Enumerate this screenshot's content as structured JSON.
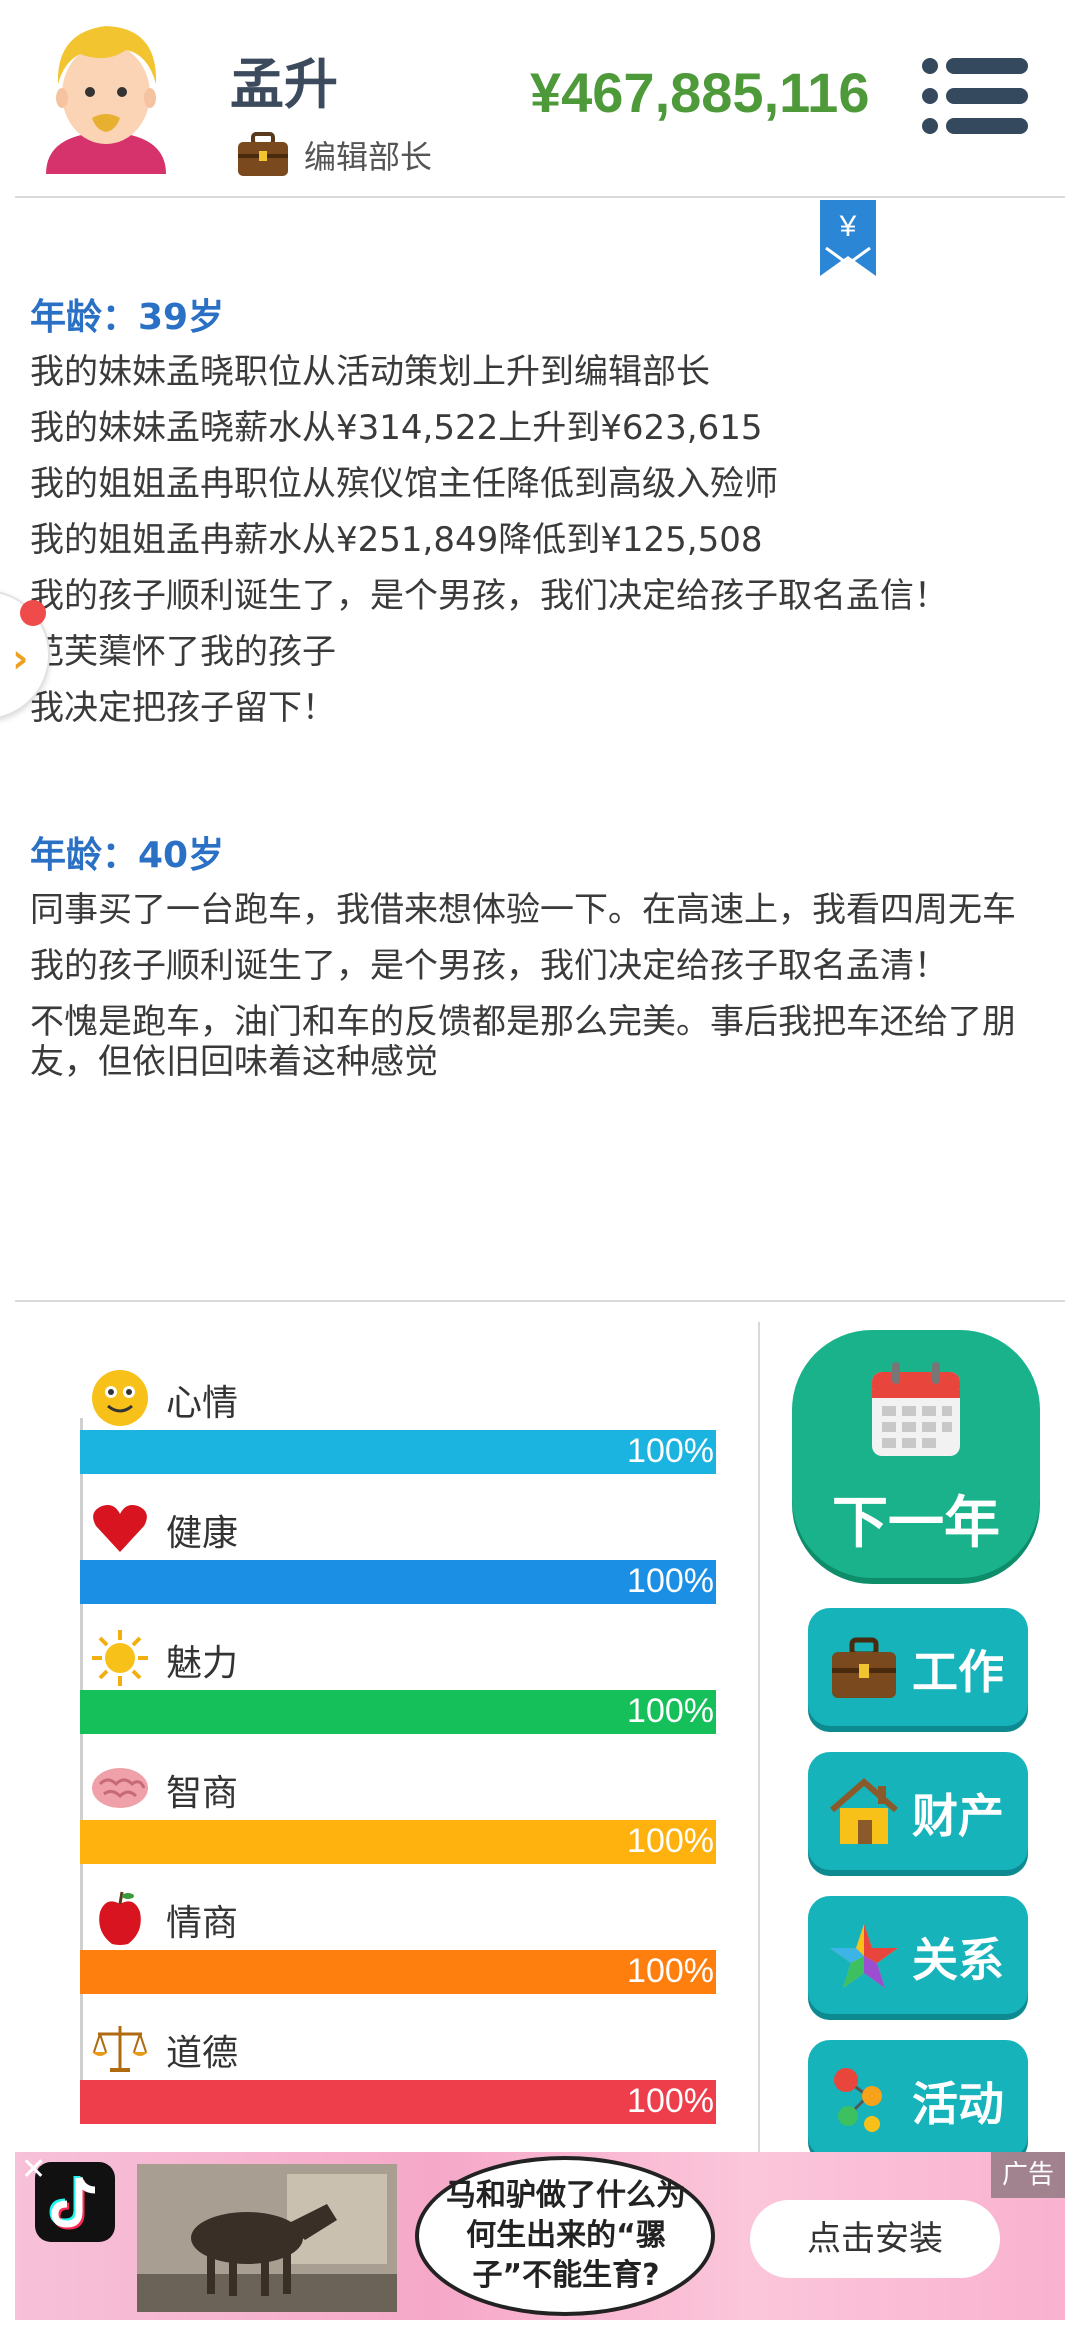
{
  "header": {
    "name": "孟升",
    "job": "编辑部长",
    "money": "¥467,885,116"
  },
  "bookmark": {
    "symbol": "¥"
  },
  "log": [
    {
      "age": "年龄：39岁",
      "lines": [
        "我的妹妹孟晓职位从活动策划上升到编辑部长",
        "我的妹妹孟晓薪水从¥314,522上升到¥623,615",
        "我的姐姐孟冉职位从殡仪馆主任降低到高级入殓师",
        "我的姐姐孟冉薪水从¥251,849降低到¥125,508",
        "我的孩子顺利诞生了，是个男孩，我们决定给孩子取名孟信！",
        "范芙蕖怀了我的孩子",
        "我决定把孩子留下！"
      ]
    },
    {
      "age": "年龄：40岁",
      "lines": [
        "同事买了一台跑车，我借来想体验一下。在高速上，我看四周无车",
        "我的孩子顺利诞生了，是个男孩，我们决定给孩子取名孟清！",
        "不愧是跑车，油门和车的反馈都是那么完美。事后我把车还给了朋友，但依旧回味着这种感觉"
      ]
    }
  ],
  "stats": [
    {
      "label": "心情",
      "value": "100%",
      "fraction": 1.0,
      "color": "#1bb3e0",
      "icon": "smiley-icon"
    },
    {
      "label": "健康",
      "value": "100%",
      "fraction": 1.0,
      "color": "#1a8fe3",
      "icon": "heart-icon"
    },
    {
      "label": "魅力",
      "value": "100%",
      "fraction": 1.0,
      "color": "#15c05a",
      "icon": "sun-icon"
    },
    {
      "label": "智商",
      "value": "100%",
      "fraction": 1.0,
      "color": "#ffb20e",
      "icon": "brain-icon"
    },
    {
      "label": "情商",
      "value": "100%",
      "fraction": 1.0,
      "color": "#ff7f0e",
      "icon": "apple-icon"
    },
    {
      "label": "道德",
      "value": "100%",
      "fraction": 1.0,
      "color": "#ee3d4b",
      "icon": "scales-icon"
    }
  ],
  "actions": {
    "next_year": "下一年",
    "work": "工作",
    "property": "财产",
    "relations": "关系",
    "activity": "活动"
  },
  "ad": {
    "bubble": "马和驴做了什么为何生出来的“骡子”不能生育?",
    "install": "点击安装",
    "tag": "广告",
    "close": "✕"
  },
  "colors": {
    "money": "#4e9a3a",
    "age": "#2a70c5",
    "next_year_bg": "#19b28a",
    "action_bg": "#16b3bb"
  }
}
